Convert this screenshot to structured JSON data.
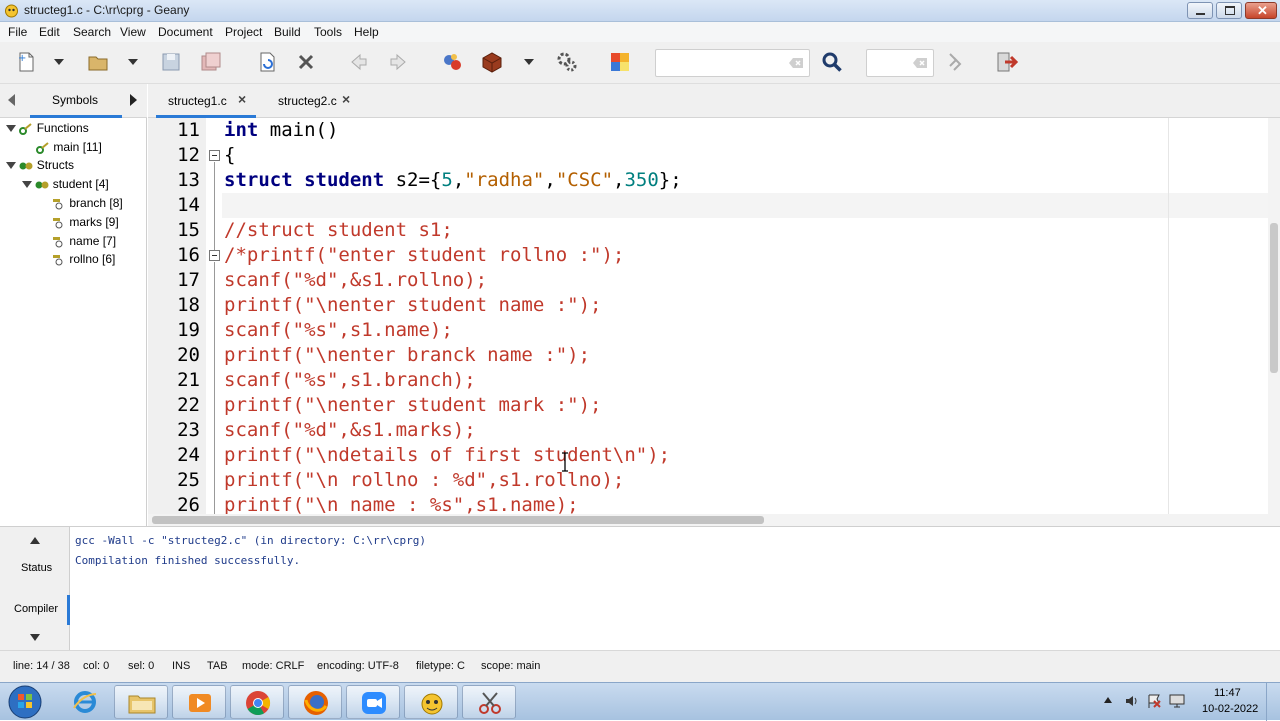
{
  "window": {
    "title": "structeg1.c - C:\\rr\\cprg - Geany"
  },
  "menu": [
    "File",
    "Edit",
    "Search",
    "View",
    "Document",
    "Project",
    "Build",
    "Tools",
    "Help"
  ],
  "sidebar": {
    "tab_label": "Symbols",
    "tree": [
      {
        "label": "Functions",
        "level": 0,
        "icon": "functions-icon"
      },
      {
        "label": "main [11]",
        "level": 1,
        "icon": "function-icon"
      },
      {
        "label": "Structs",
        "level": 0,
        "icon": "structs-icon"
      },
      {
        "label": "student [4]",
        "level": 1,
        "icon": "struct-icon"
      },
      {
        "label": "branch [8]",
        "level": 2,
        "icon": "member-icon"
      },
      {
        "label": "marks [9]",
        "level": 2,
        "icon": "member-icon"
      },
      {
        "label": "name [7]",
        "level": 2,
        "icon": "member-icon"
      },
      {
        "label": "rollno [6]",
        "level": 2,
        "icon": "member-icon"
      }
    ]
  },
  "tabs": [
    {
      "label": "structeg1.c",
      "active": true
    },
    {
      "label": "structeg2.c",
      "active": false
    }
  ],
  "editor": {
    "line_numbers": [
      "11",
      "12",
      "13",
      "14",
      "15",
      "16",
      "17",
      "18",
      "19",
      "20",
      "21",
      "22",
      "23",
      "24",
      "25",
      "26"
    ],
    "lines": {
      "l11a": "int",
      "l11b": " main()",
      "l12": "{",
      "l13a": "struct",
      "l13b": " ",
      "l13c": "student",
      "l13d": " s2={",
      "l13e": "5",
      "l13f": ",",
      "l13g": "\"radha\"",
      "l13h": ",",
      "l13i": "\"CSC\"",
      "l13j": ",",
      "l13k": "350",
      "l13l": "};",
      "l15": "//struct student s1;",
      "l16": "/*printf(\"enter student rollno :\");",
      "l17": "scanf(\"%d\",&s1.rollno);",
      "l18": "printf(\"\\nenter student name :\");",
      "l19": "scanf(\"%s\",s1.name);",
      "l20": "printf(\"\\nenter branck name :\");",
      "l21": "scanf(\"%s\",s1.branch);",
      "l22": "printf(\"\\nenter student mark :\");",
      "l23": "scanf(\"%d\",&s1.marks);",
      "l24": "printf(\"\\ndetails of first student\\n\");",
      "l25": "printf(\"\\n rollno : %d\",s1.rollno);",
      "l26": "printf(\"\\n name : %s\",s1.name);"
    }
  },
  "messages": {
    "tab_status": "Status",
    "tab_compiler": "Compiler",
    "line1": "gcc -Wall -c \"structeg2.c\" (in directory: C:\\rr\\cprg)",
    "line2": "Compilation finished successfully."
  },
  "statusbar": {
    "line": "line: 14 / 38",
    "col": "col: 0",
    "sel": "sel: 0",
    "ins": "INS",
    "tab": "TAB",
    "mode": "mode: CRLF",
    "encoding": "encoding: UTF-8",
    "filetype": "filetype: C",
    "scope": "scope: main"
  },
  "taskbar": {
    "time": "11:47",
    "date": "10-02-2022"
  },
  "colors": {
    "keyword": "#00007f",
    "string": "#b35f00",
    "number": "#007f7f",
    "comment": "#c0392b"
  }
}
